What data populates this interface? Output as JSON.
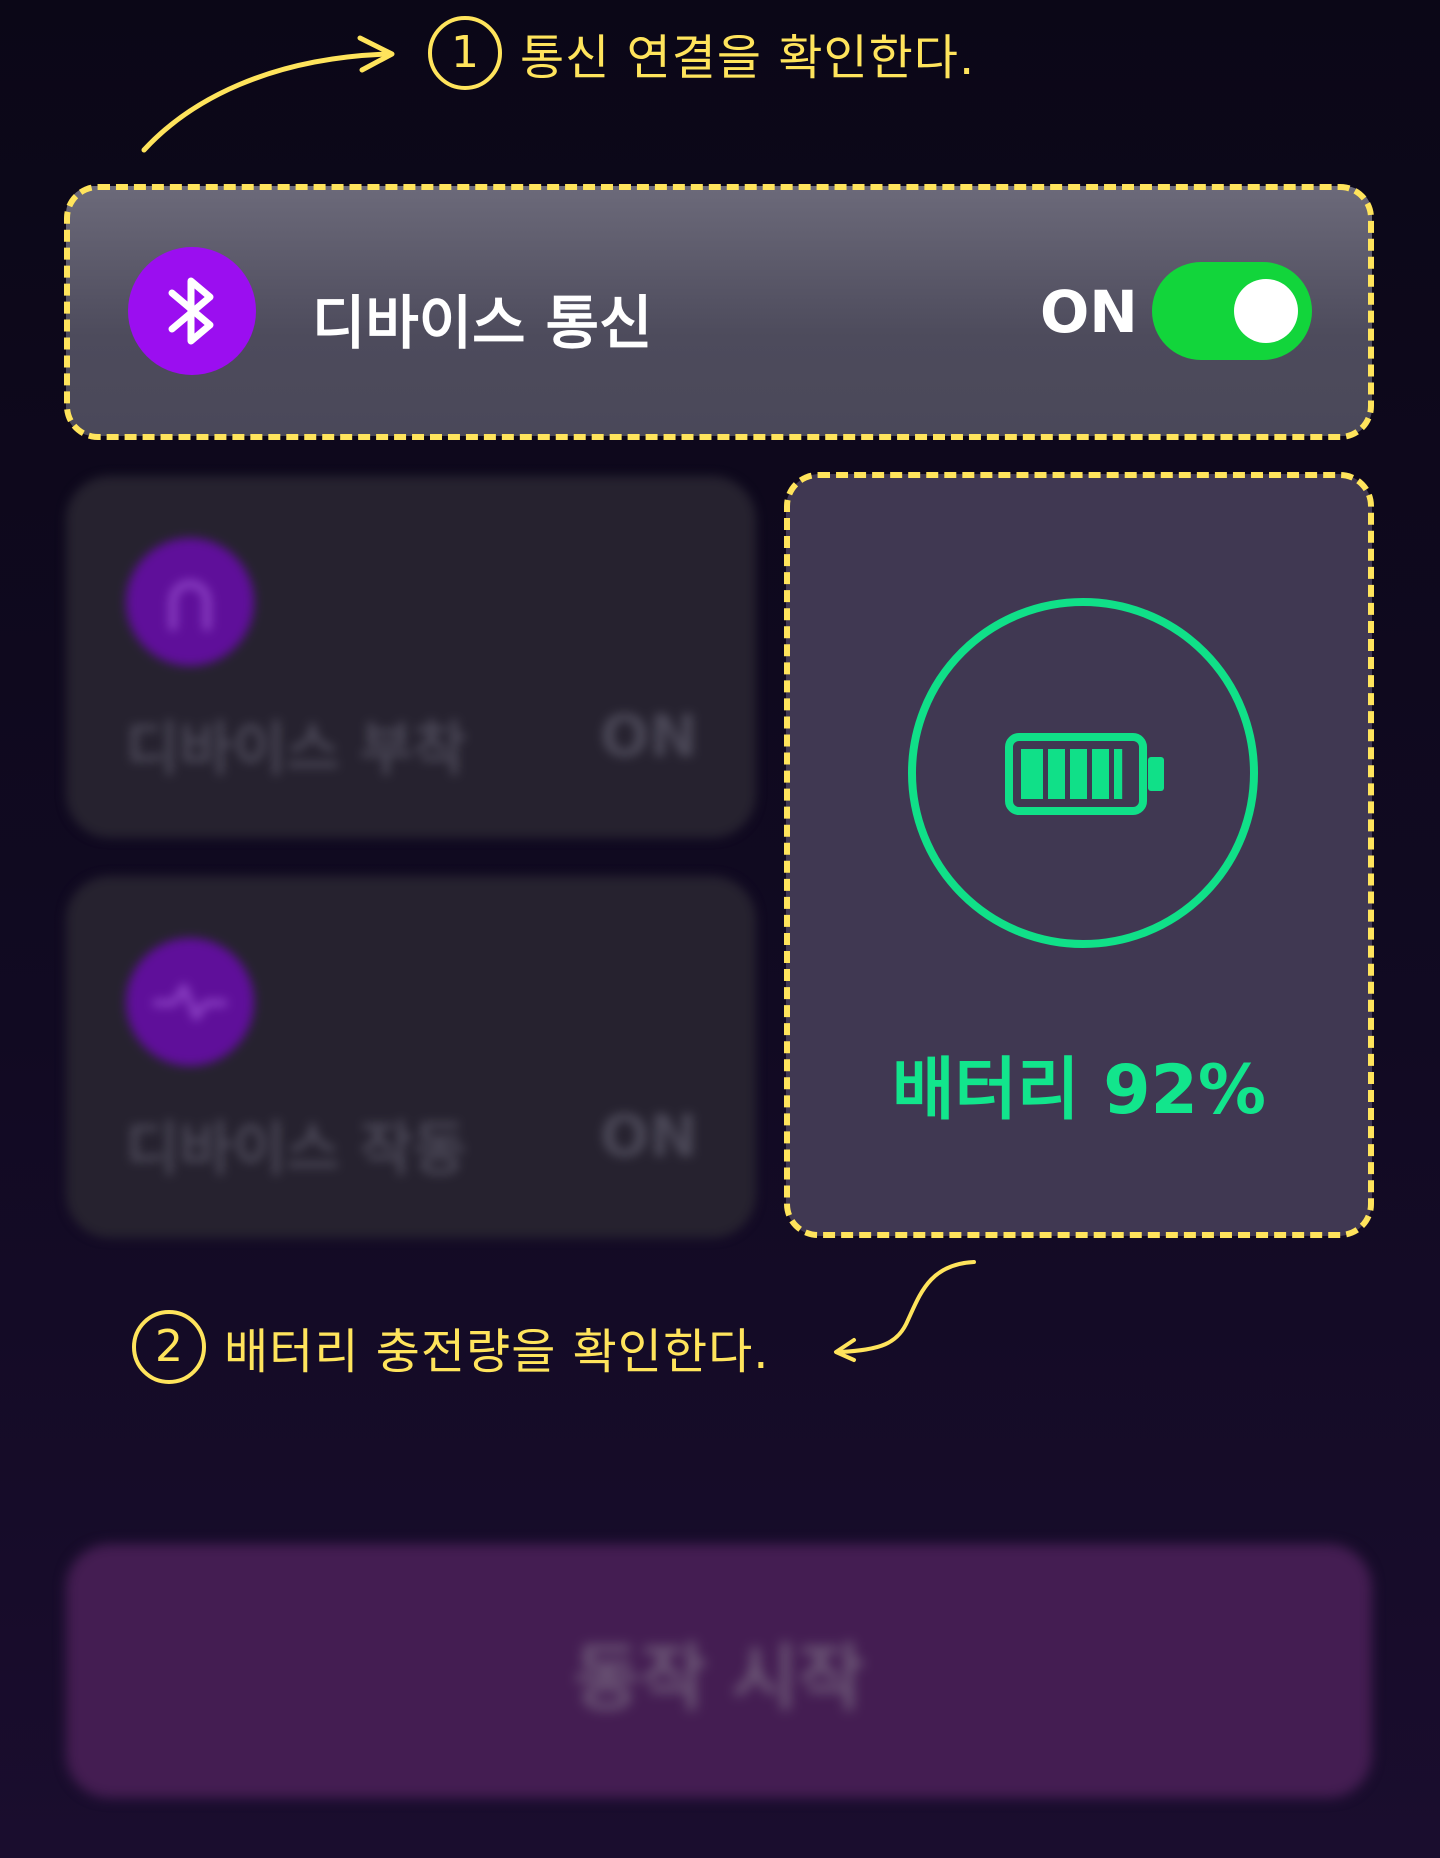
{
  "annotations": {
    "step1": {
      "number": "1",
      "text": "통신 연결을 확인한다."
    },
    "step2": {
      "number": "2",
      "text": "배터리 충전량을 확인한다."
    }
  },
  "connection_card": {
    "title": "디바이스 통신",
    "icon": "bluetooth-icon",
    "toggle_label": "ON",
    "toggle_on": true
  },
  "feature_cards": [
    {
      "label": "디바이스 부착",
      "status": "ON",
      "icon": "horseshoe-icon"
    },
    {
      "label": "디바이스 작동",
      "status": "ON",
      "icon": "pulse-icon"
    }
  ],
  "battery": {
    "label": "배터리 92%",
    "level_percent": 92,
    "icon": "battery-icon"
  },
  "start_button": {
    "label": "동작 시작"
  },
  "colors": {
    "annotation": "#ffe45c",
    "accent_purple": "#9b0ef0",
    "toggle_green": "#12d53b",
    "battery_green": "#12e58c",
    "background": "#0b0717"
  }
}
